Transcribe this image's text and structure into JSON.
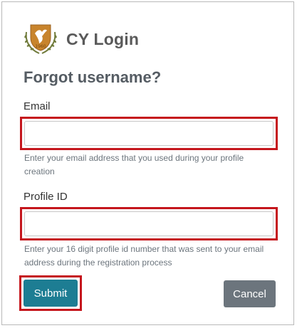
{
  "brand": {
    "title": "CY Login",
    "logo_icon": "cyprus-coat-of-arms"
  },
  "form": {
    "heading": "Forgot username?",
    "email": {
      "label": "Email",
      "value": "",
      "help": "Enter your email address that you used during your profile creation"
    },
    "profile_id": {
      "label": "Profile ID",
      "value": "",
      "help": "Enter your 16 digit profile id number that was sent to your email address during the registration process"
    },
    "submit_label": "Submit",
    "cancel_label": "Cancel"
  },
  "colors": {
    "submit": "#1d7d93",
    "cancel": "#6c757d",
    "highlight": "#c5161d",
    "heading": "#555c63"
  }
}
